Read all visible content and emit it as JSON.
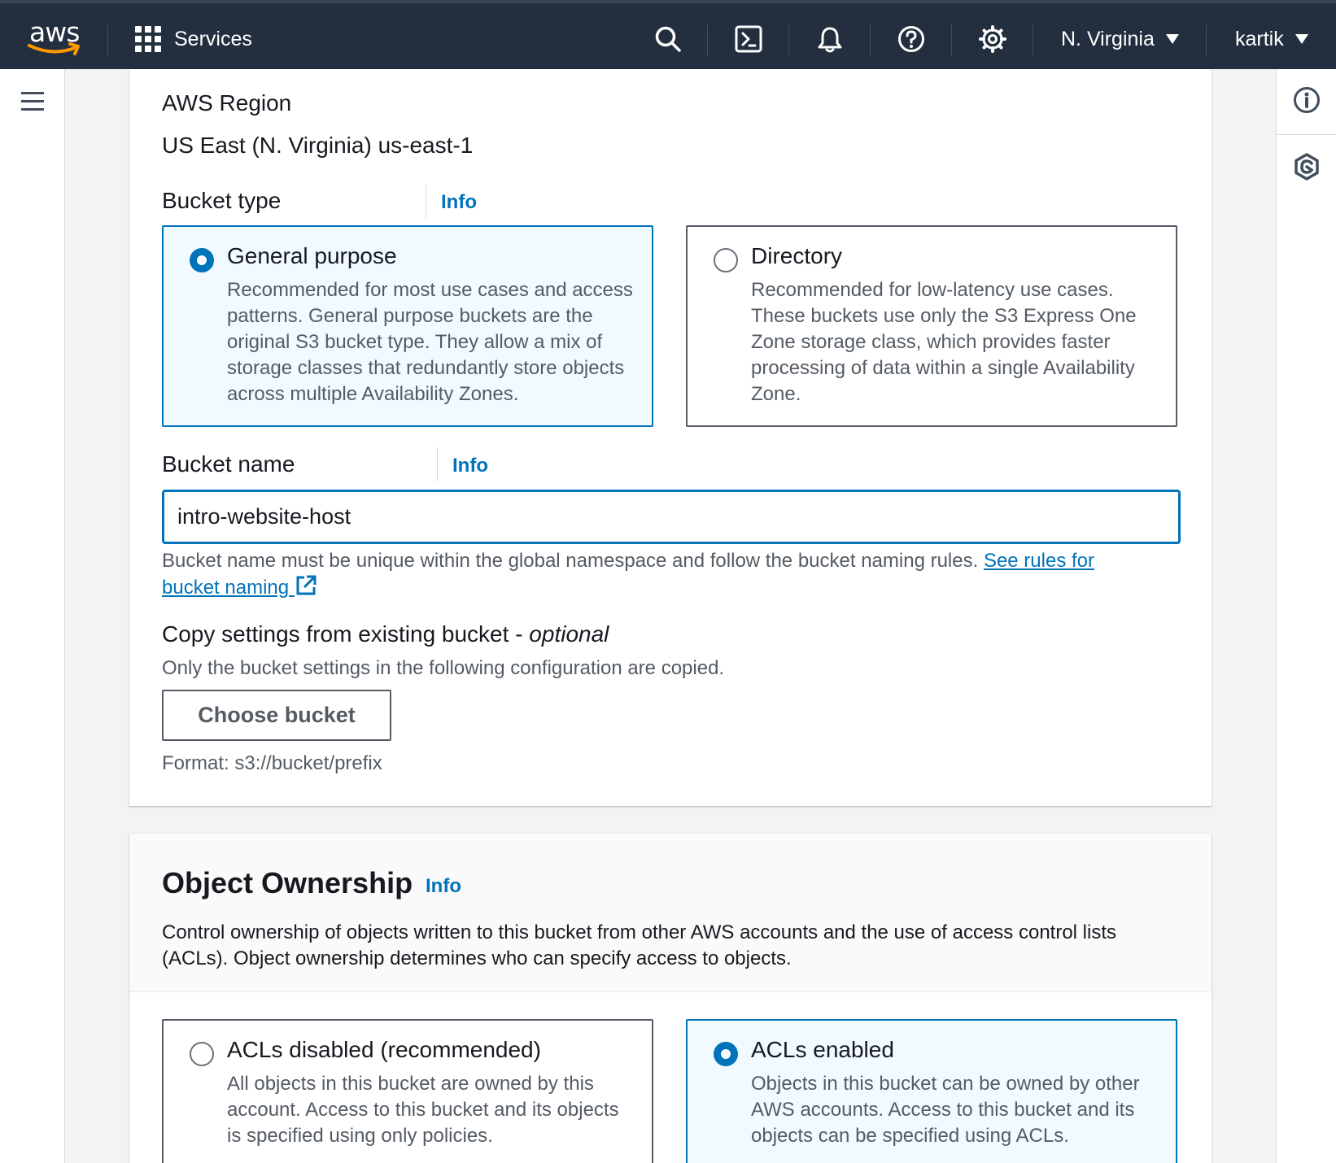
{
  "nav": {
    "logo_text": "aws",
    "services_label": "Services",
    "region_label": "N. Virginia",
    "user_label": "kartik"
  },
  "colors": {
    "nav_bg": "#232f3e",
    "accent": "#0073bb",
    "logo_smile": "#ff9900",
    "selected_tile_bg": "#f1faff"
  },
  "general": {
    "region_label": "AWS Region",
    "region_value": "US East (N. Virginia) us-east-1",
    "bucket_type_label": "Bucket type",
    "bucket_type_info": "Info",
    "bucket_types": [
      {
        "title": "General purpose",
        "description": "Recommended for most use cases and access patterns. General purpose buckets are the original S3 bucket type. They allow a mix of storage classes that redundantly store objects across multiple Availability Zones.",
        "selected": true
      },
      {
        "title": "Directory",
        "description": "Recommended for low-latency use cases. These buckets use only the S3 Express One Zone storage class, which provides faster processing of data within a single Availability Zone.",
        "selected": false
      }
    ],
    "bucket_name_label": "Bucket name",
    "bucket_name_info": "Info",
    "bucket_name_value": "intro-website-host",
    "bucket_name_help": "Bucket name must be unique within the global namespace and follow the bucket naming rules.",
    "bucket_name_link": "See rules for bucket naming",
    "copy_label": "Copy settings from existing bucket - ",
    "copy_label_optional": "optional",
    "copy_help": "Only the bucket settings in the following configuration are copied.",
    "choose_button": "Choose bucket",
    "format_hint": "Format: s3://bucket/prefix"
  },
  "ownership": {
    "title": "Object Ownership",
    "info": "Info",
    "description": "Control ownership of objects written to this bucket from other AWS accounts and the use of access control lists (ACLs). Object ownership determines who can specify access to objects.",
    "options": [
      {
        "title": "ACLs disabled (recommended)",
        "description": "All objects in this bucket are owned by this account. Access to this bucket and its objects is specified using only policies.",
        "selected": false
      },
      {
        "title": "ACLs enabled",
        "description": "Objects in this bucket can be owned by other AWS accounts. Access to this bucket and its objects can be specified using ACLs.",
        "selected": true
      }
    ]
  }
}
